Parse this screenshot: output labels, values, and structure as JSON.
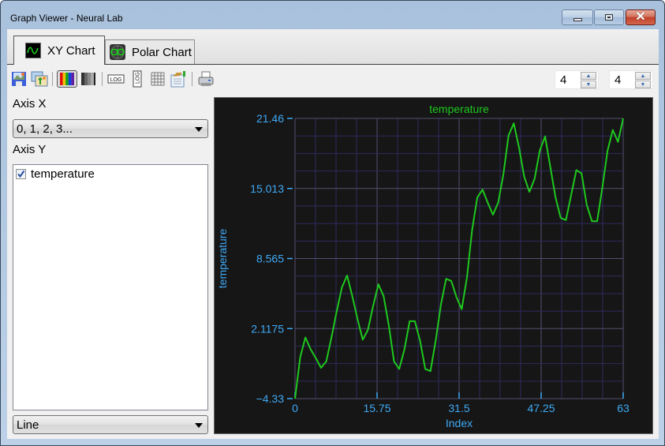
{
  "window": {
    "title": "Graph Viewer - Neural Lab",
    "controls": {
      "minimize": "minimize",
      "maximize": "maximize",
      "close": "close"
    }
  },
  "tabs": [
    {
      "label": "XY Chart",
      "icon": "sine-wave-icon",
      "active": true
    },
    {
      "label": "Polar Chart",
      "icon": "polar-chart-icon",
      "active": false
    }
  ],
  "toolbar": {
    "buttons": [
      {
        "name": "save-image-icon",
        "pressed": false
      },
      {
        "name": "export-image-icon",
        "pressed": false
      },
      {
        "name": "color-palette-icon",
        "pressed": true
      },
      {
        "name": "grayscale-palette-icon",
        "pressed": false
      },
      {
        "name": "log-x-icon",
        "pressed": false
      },
      {
        "name": "log-y-icon",
        "pressed": false
      },
      {
        "name": "grid-icon",
        "pressed": false
      },
      {
        "name": "properties-icon",
        "pressed": false
      },
      {
        "name": "print-icon",
        "pressed": false
      }
    ],
    "spinner_x": {
      "value": "4"
    },
    "spinner_y": {
      "value": "4"
    }
  },
  "left_panel": {
    "axis_x_label": "Axis X",
    "axis_x_value": "0, 1, 2, 3...",
    "axis_y_label": "Axis Y",
    "series_list": [
      {
        "label": "temperature",
        "checked": true
      }
    ],
    "plot_type": "Line"
  },
  "colors": {
    "chart_bg": "#161616",
    "line": "#1ec81e",
    "title": "#1ec81e",
    "axis_text": "#3fa9f5",
    "grid_minor": "#2d2b5e",
    "grid_major": "#54506e"
  },
  "chart_data": {
    "type": "line",
    "title": "temperature",
    "xlabel": "Index",
    "ylabel": "temperature",
    "xlim": [
      0,
      63
    ],
    "ylim": [
      -4.33,
      21.46
    ],
    "x_ticks": [
      "0",
      "15.75",
      "31.5",
      "47.25",
      "63"
    ],
    "y_ticks": [
      "-4.33",
      "2.1175",
      "8.565",
      "15.013",
      "21.46"
    ],
    "grid": true,
    "legend": "none",
    "series": [
      {
        "name": "temperature",
        "x": [
          0,
          1,
          2,
          3,
          4,
          5,
          6,
          7,
          8,
          9,
          10,
          11,
          12,
          13,
          14,
          15,
          16,
          17,
          18,
          19,
          20,
          21,
          22,
          23,
          24,
          25,
          26,
          27,
          28,
          29,
          30,
          31,
          32,
          33,
          34,
          35,
          36,
          37,
          38,
          39,
          40,
          41,
          42,
          43,
          44,
          45,
          46,
          47,
          48,
          49,
          50,
          51,
          52,
          53,
          54,
          55,
          56,
          57,
          58,
          59,
          60,
          61,
          62,
          63
        ],
        "values": [
          -4.33,
          -0.5,
          1.3,
          0.2,
          -0.6,
          -1.5,
          -0.9,
          1.3,
          3.7,
          5.9,
          7.0,
          5.1,
          3.0,
          1.1,
          2.0,
          4.2,
          6.2,
          5.1,
          2.4,
          -0.9,
          -1.6,
          0.2,
          2.8,
          2.8,
          1.0,
          -1.6,
          -1.8,
          1.0,
          4.3,
          6.7,
          6.5,
          5.0,
          3.9,
          6.8,
          11.2,
          14.2,
          14.9,
          13.7,
          12.6,
          13.7,
          16.3,
          19.9,
          21.0,
          18.8,
          16.1,
          14.7,
          15.9,
          18.5,
          19.8,
          17.0,
          14.2,
          12.3,
          12.1,
          14.4,
          16.7,
          16.4,
          13.5,
          12.0,
          12.0,
          15.1,
          18.5,
          20.4,
          19.3,
          21.46
        ]
      }
    ]
  }
}
